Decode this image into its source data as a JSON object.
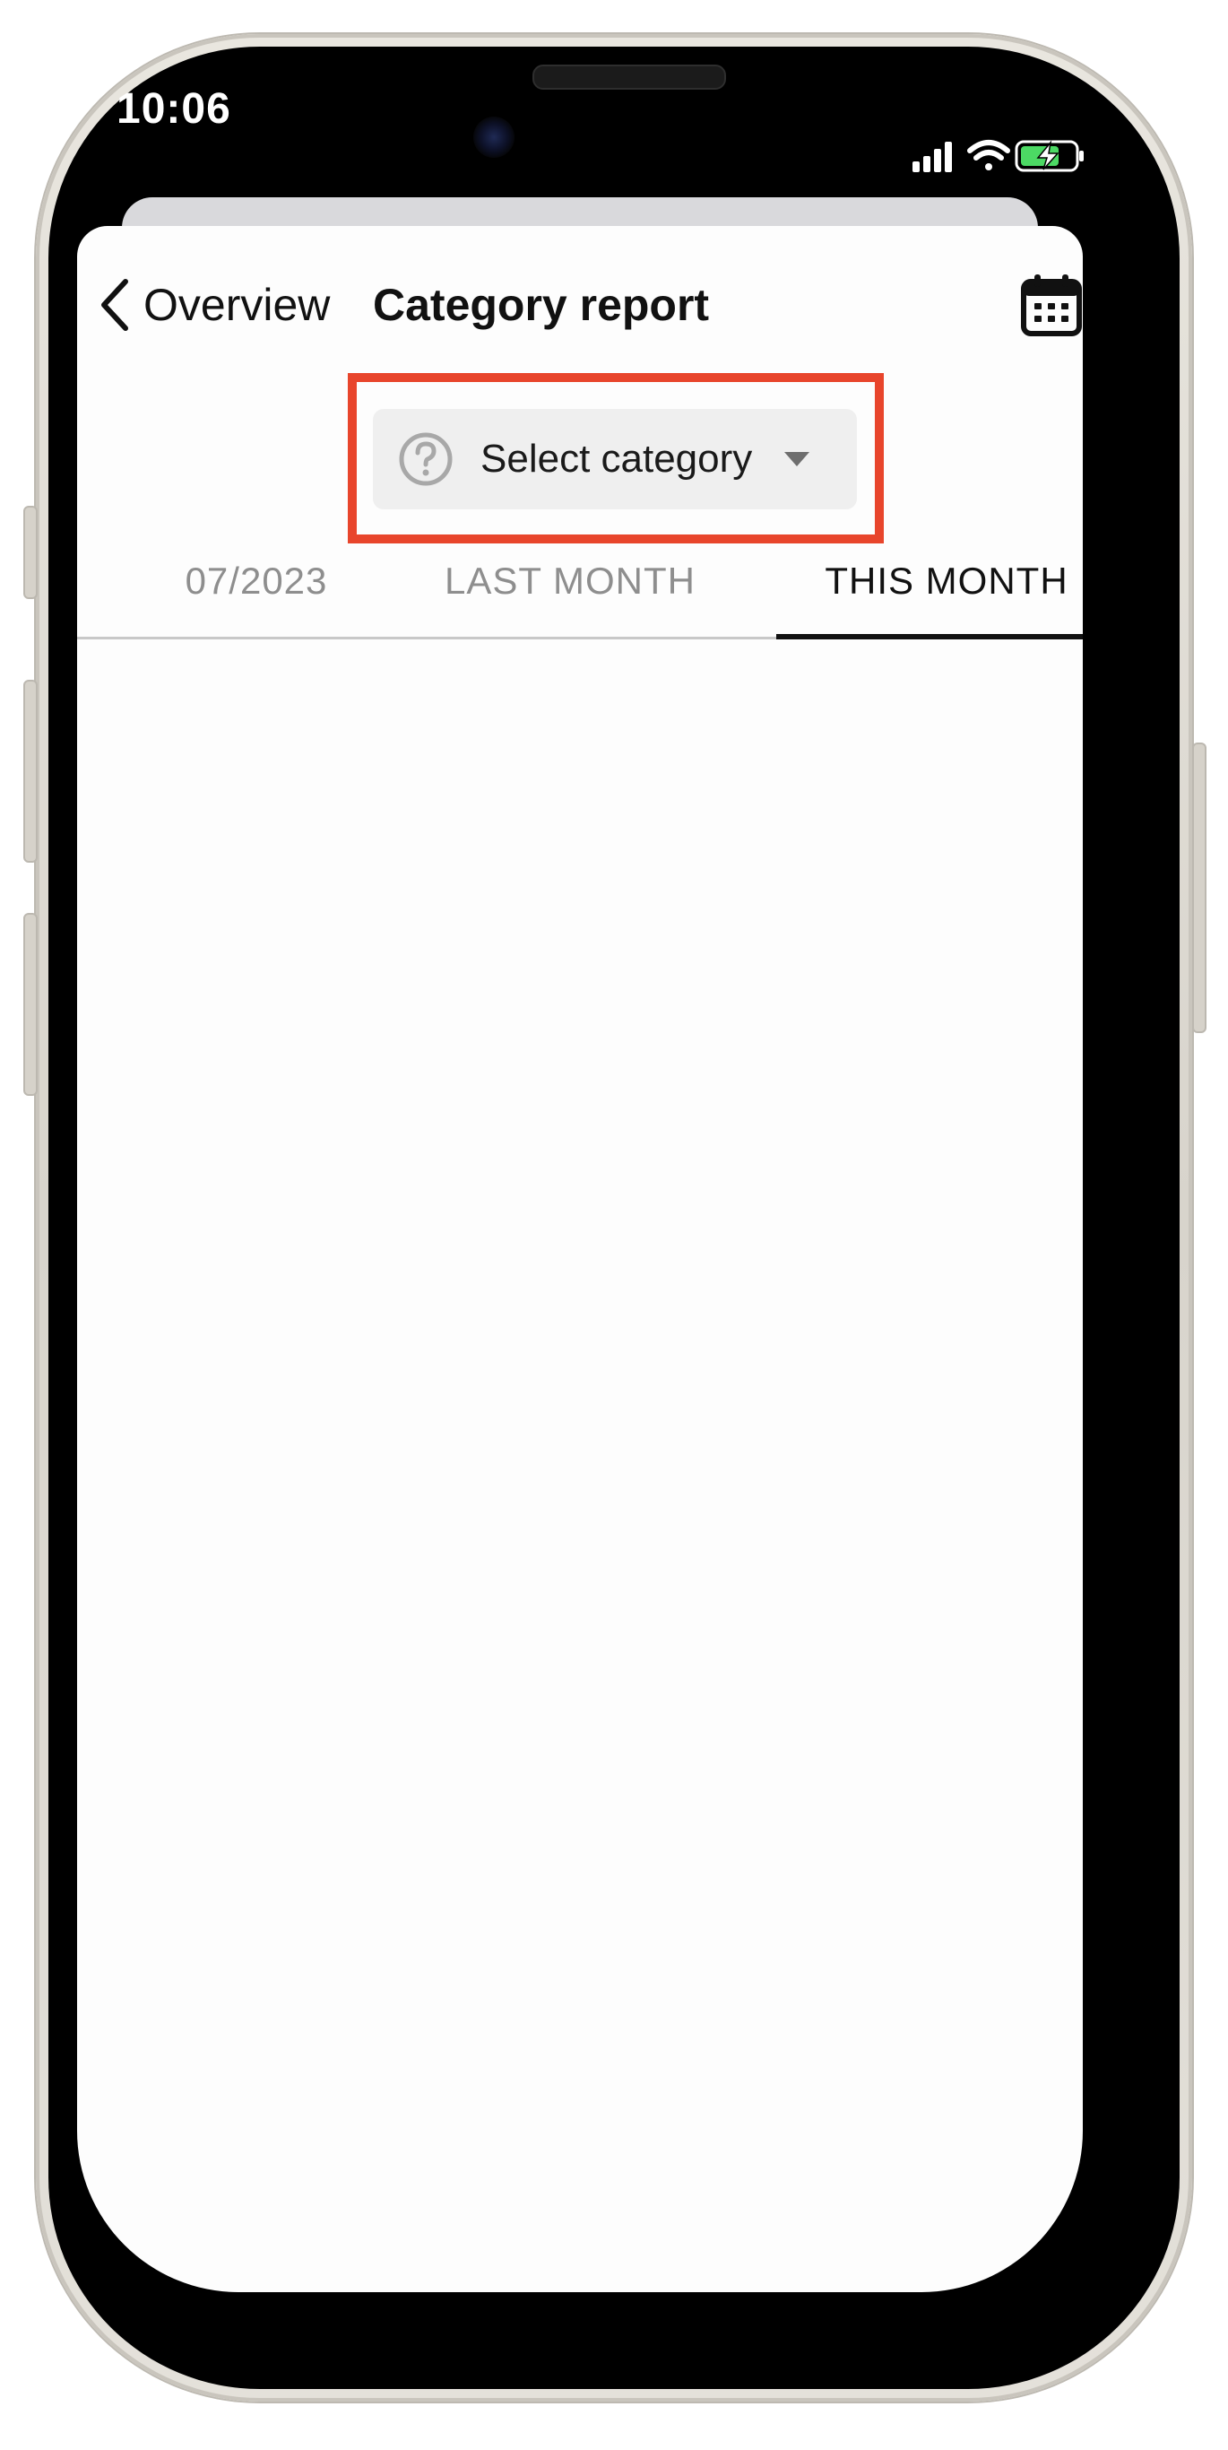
{
  "status_bar": {
    "time": "10:06",
    "icons": [
      "signal-icon",
      "wifi-icon",
      "battery-charging-icon"
    ],
    "battery_color": "#4cd964"
  },
  "nav": {
    "back_label": "Overview",
    "title": "Category report",
    "right_icon": "calendar-icon"
  },
  "category_select": {
    "label": "Select category",
    "icon": "question-circle-icon",
    "dropdown_icon": "caret-down-icon"
  },
  "highlight": {
    "color": "#e8452c"
  },
  "tabs": [
    {
      "label": "07/2023",
      "active": false
    },
    {
      "label": "LAST MONTH",
      "active": false
    },
    {
      "label": "THIS MONTH",
      "active": true
    }
  ]
}
